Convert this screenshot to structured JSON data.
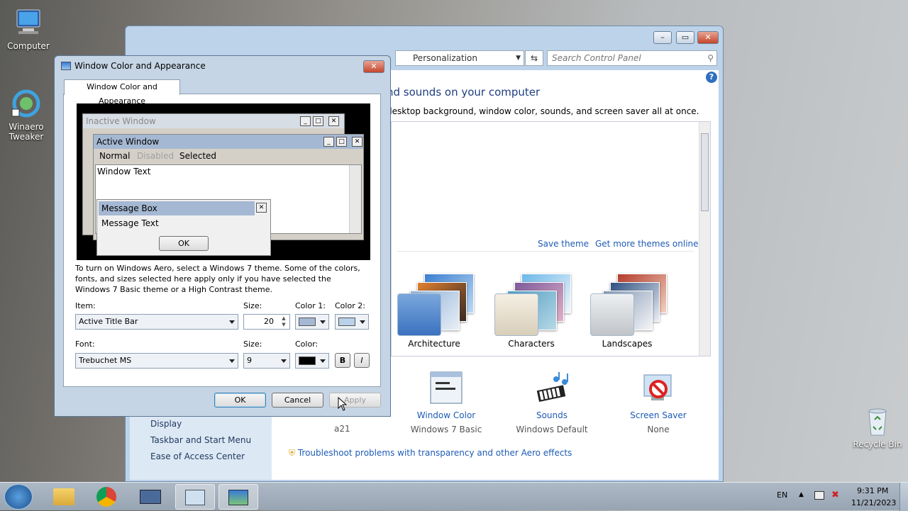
{
  "desktop": {
    "computer": "Computer",
    "tweaker": "Winaero Tweaker",
    "recycle": "Recycle Bin"
  },
  "cp": {
    "breadcrumb": "Personalization",
    "search_placeholder": "Search Control Panel",
    "heading": "nd sounds on your computer",
    "subheading": "desktop background, window color, sounds, and screen saver all at once.",
    "save_theme": "Save theme",
    "more_themes": "Get more themes online",
    "themes": [
      {
        "label": "Architecture"
      },
      {
        "label": "Characters"
      },
      {
        "label": "Landscapes"
      }
    ],
    "bottom": [
      {
        "label": "Window Color",
        "value": "Windows 7 Basic"
      },
      {
        "label": "Sounds",
        "value": "Windows Default"
      },
      {
        "label": "Screen Saver",
        "value": "None"
      }
    ],
    "bg_value": "a21",
    "nav_links": [
      "Display",
      "Taskbar and Start Menu",
      "Ease of Access Center"
    ],
    "troubleshoot": "Troubleshoot problems with transparency and other Aero effects"
  },
  "dlg": {
    "title": "Window Color and Appearance",
    "tab": "Window Color and Appearance",
    "preview": {
      "inactive": "Inactive Window",
      "active": "Active Window",
      "normal": "Normal",
      "disabled": "Disabled",
      "selected": "Selected",
      "window_text": "Window Text",
      "msgbox": "Message Box",
      "msgtext": "Message Text",
      "ok": "OK"
    },
    "info": "To turn on Windows Aero, select a Windows 7 theme.  Some of the colors, fonts, and sizes selected here apply only if you have selected the Windows 7 Basic theme or a High Contrast theme.",
    "item_label": "Item:",
    "item_value": "Active Title Bar",
    "size_label": "Size:",
    "size_value": "20",
    "color1_label": "Color 1:",
    "color2_label": "Color 2:",
    "color1": "#a5b8d3",
    "color2": "#b9d1ea",
    "font_label": "Font:",
    "font_value": "Trebuchet MS",
    "fsize_label": "Size:",
    "fsize_value": "9",
    "fcolor_label": "Color:",
    "fcolor": "#000000",
    "bold": "B",
    "italic": "I",
    "ok": "OK",
    "cancel": "Cancel",
    "apply": "Apply"
  },
  "tray": {
    "lang": "EN",
    "time": "9:31 PM",
    "date": "11/21/2023"
  }
}
